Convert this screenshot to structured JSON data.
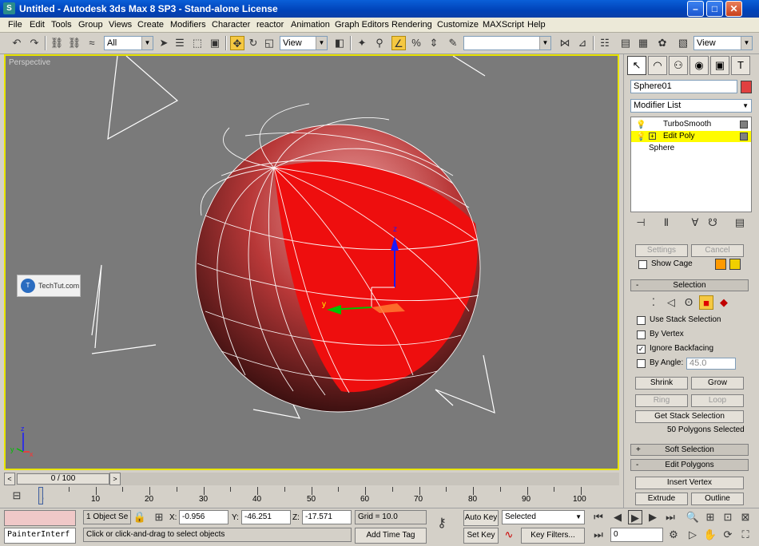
{
  "window": {
    "title": "Untitled - Autodesk 3ds Max 8 SP3 - Stand-alone License"
  },
  "menu": [
    "File",
    "Edit",
    "Tools",
    "Group",
    "Views",
    "Create",
    "Modifiers",
    "Character",
    "reactor",
    "Animation",
    "Graph Editors",
    "Rendering",
    "Customize",
    "MAXScript",
    "Help"
  ],
  "toolbar": {
    "selection_filter": "All",
    "ref_coord": "View",
    "named_selection": "",
    "view_dropdown": "View"
  },
  "viewport": {
    "label": "Perspective",
    "watermark": "TechTut.com",
    "axis_y": "y",
    "axis_z": "z",
    "small_axis_z": "z",
    "small_axis_x": "x",
    "small_axis_y": "y"
  },
  "panel": {
    "object_name": "Sphere01",
    "object_color": "#e04040",
    "modifier_list": "Modifier List",
    "stack": [
      {
        "name": "TurboSmooth",
        "highlight": false
      },
      {
        "name": "Edit Poly",
        "highlight": true
      },
      {
        "name": "Sphere",
        "highlight": false
      }
    ],
    "top_buttons": [
      "Settings",
      "Cancel"
    ],
    "show_cage": "Show Cage",
    "selection_rollout": "Selection",
    "use_stack_selection": "Use Stack Selection",
    "by_vertex": "By Vertex",
    "ignore_backfacing": "Ignore Backfacing",
    "by_angle": "By Angle:",
    "by_angle_value": "45.0",
    "shrink": "Shrink",
    "grow": "Grow",
    "ring": "Ring",
    "loop": "Loop",
    "get_stack_selection": "Get Stack Selection",
    "selection_status": "50 Polygons Selected",
    "soft_selection": "Soft Selection",
    "edit_polygons": "Edit Polygons",
    "insert_vertex": "Insert Vertex",
    "extrude": "Extrude",
    "outline": "Outline"
  },
  "timeline": {
    "frame": "0 / 100",
    "ticks": [
      "0",
      "10",
      "20",
      "30",
      "40",
      "50",
      "60",
      "70",
      "80",
      "90",
      "100"
    ]
  },
  "status": {
    "maxscript": "PainterInterf",
    "object_count": "1 Object Se",
    "x_label": "X:",
    "x": "-0.956",
    "y_label": "Y:",
    "y": "-46.251",
    "z_label": "Z:",
    "z": "-17.571",
    "grid": "Grid = 10.0",
    "prompt": "Click or click-and-drag to select objects",
    "add_time_tag": "Add Time Tag",
    "auto_key": "Auto Key",
    "set_key": "Set Key",
    "key_mode": "Selected",
    "key_filters": "Key Filters...",
    "current_frame": "0"
  }
}
